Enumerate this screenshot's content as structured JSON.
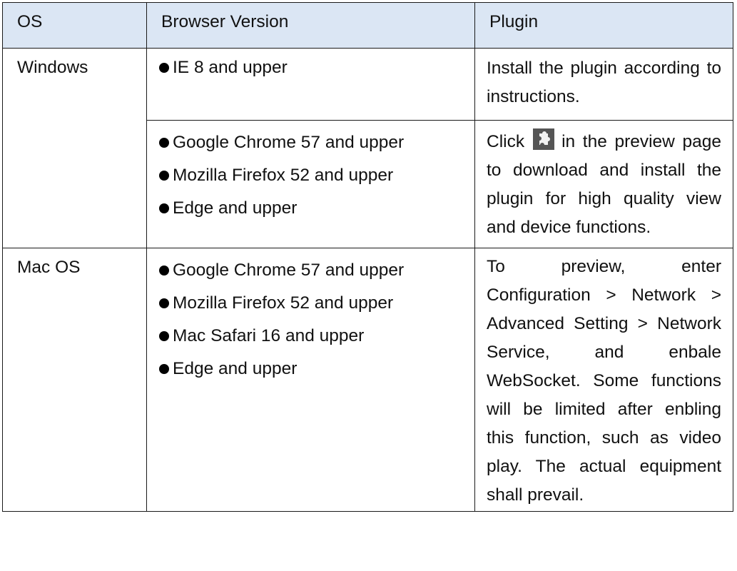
{
  "table": {
    "headers": {
      "os": "OS",
      "browser_version": "Browser Version",
      "plugin": "Plugin"
    },
    "rows": [
      {
        "os": "Windows",
        "groups": [
          {
            "browsers": [
              "IE 8 and upper"
            ],
            "plugin_text": "Install the plugin according to instructions."
          },
          {
            "browsers": [
              "Google Chrome 57 and upper",
              "Mozilla Firefox 52 and upper",
              "Edge and upper"
            ],
            "plugin_before_icon": "Click",
            "plugin_icon": "plugin-puzzle-icon",
            "plugin_after_icon": "in the preview page to download and install the plugin for high quality view and device functions."
          }
        ]
      },
      {
        "os": "Mac OS",
        "groups": [
          {
            "browsers": [
              "Google Chrome 57 and upper",
              "Mozilla Firefox 52 and upper",
              "Mac Safari 16 and upper",
              "Edge and upper"
            ],
            "plugin_text": "To preview, enter Configuration > Network > Advanced Setting > Network Service, and enbale WebSocket. Some functions will be limited after enbling this function, such as video play. The actual equipment shall prevail."
          }
        ]
      }
    ]
  },
  "colors": {
    "header_background": "#dbe6f4",
    "border": "#1a1a1a",
    "text": "#111111",
    "icon_background": "#555555",
    "icon_foreground": "#f2f2f2"
  }
}
